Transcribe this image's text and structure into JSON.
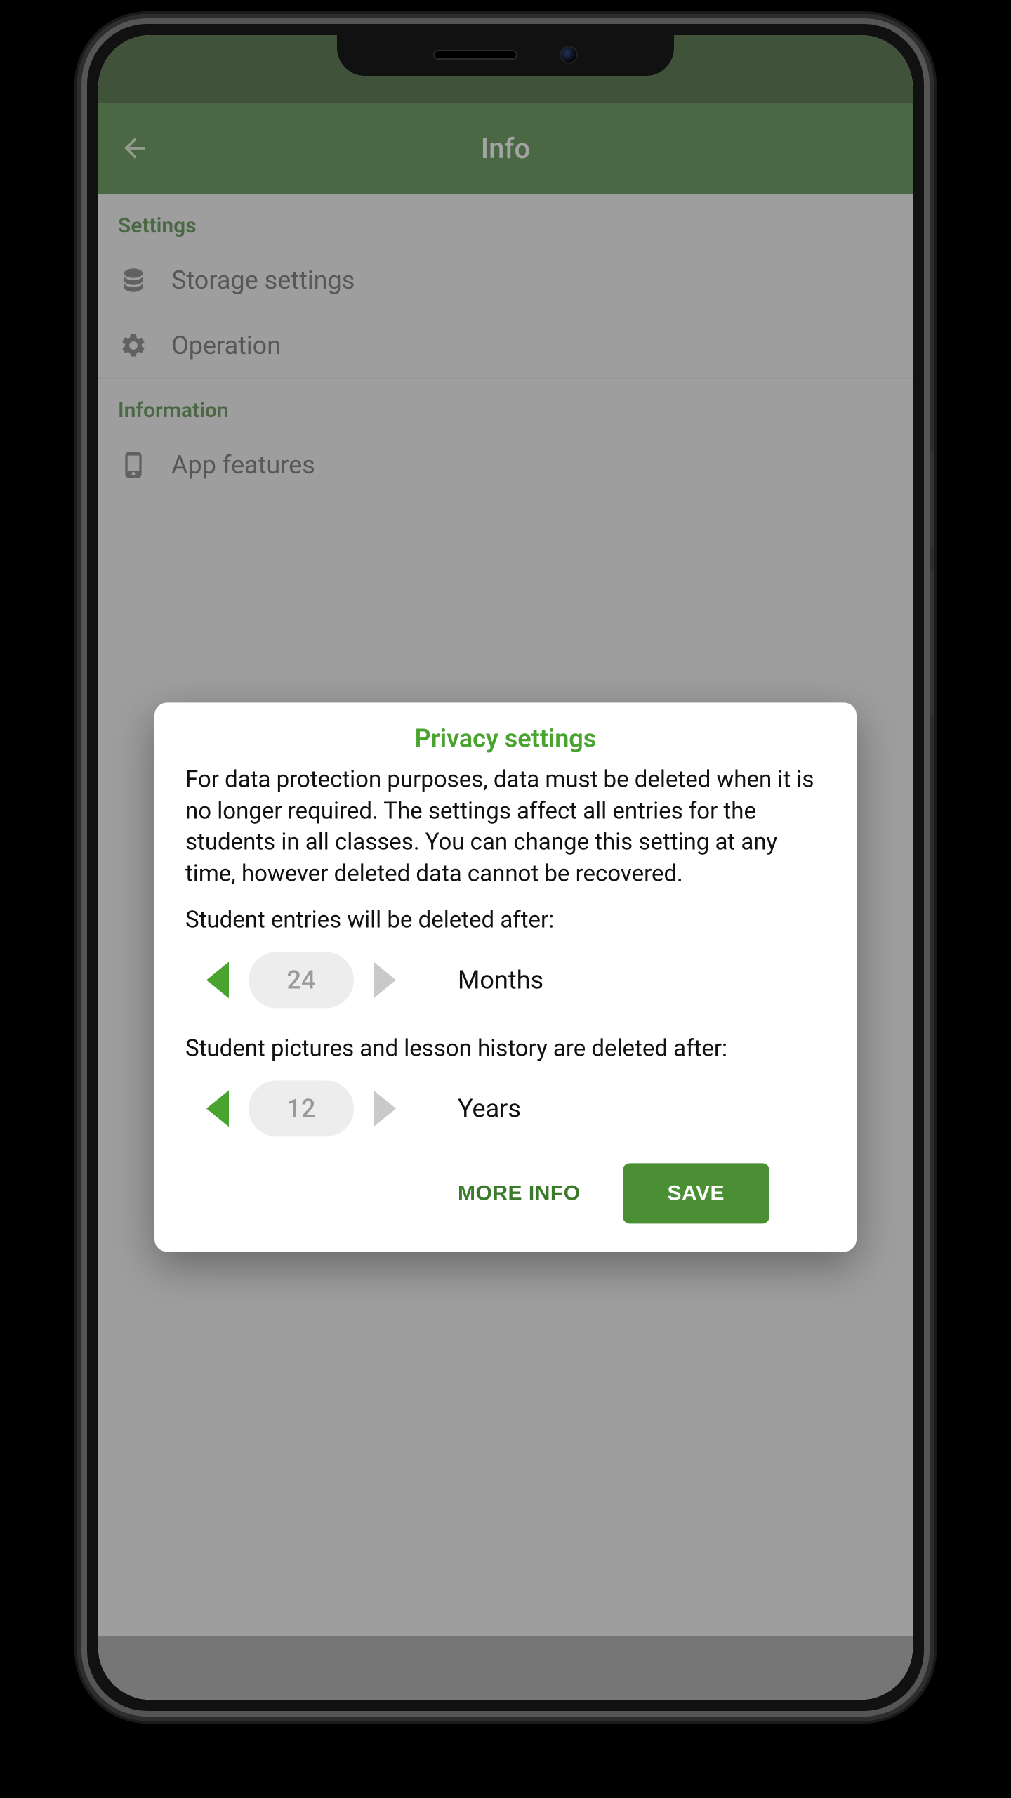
{
  "colors": {
    "accent": "#48a32f",
    "appbar": "#3b7a2a",
    "appbar_dark": "#234915"
  },
  "appbar": {
    "title": "Info",
    "back_icon": "arrow-left-icon"
  },
  "sections": [
    {
      "header": "Settings",
      "items": [
        {
          "icon": "storage-icon",
          "label": "Storage settings"
        },
        {
          "icon": "gears-icon",
          "label": "Operation"
        }
      ]
    },
    {
      "header": "Information",
      "items": [
        {
          "icon": "phone-icon",
          "label": "App features"
        }
      ]
    }
  ],
  "dialog": {
    "title": "Privacy settings",
    "body": "For data protection purposes, data must be deleted when it is no longer required. The settings affect all entries for the students in all classes. You can change this setting at any time, however deleted data cannot be recovered.",
    "entries_label": "Student entries will be deleted after:",
    "entries_value": "24",
    "entries_unit": "Months",
    "pictures_label": "Student pictures and lesson history are deleted after:",
    "pictures_value": "12",
    "pictures_unit": "Years",
    "more_info": "MORE INFO",
    "save": "SAVE"
  }
}
